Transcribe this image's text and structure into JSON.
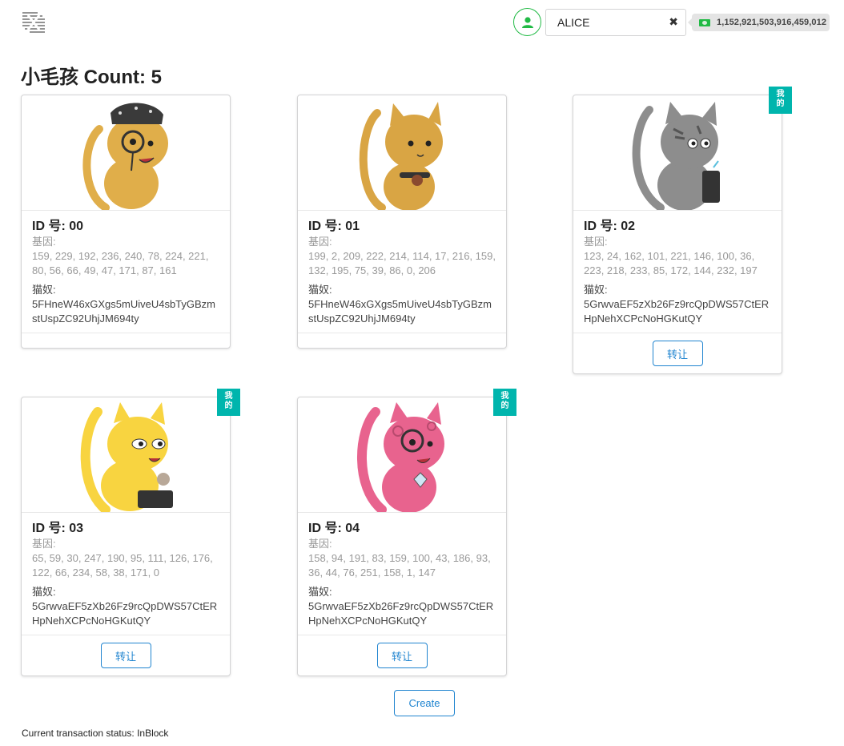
{
  "header": {
    "account_name": "ALICE",
    "account_clear_icon": "close-icon",
    "balance": "1,152,921,503,916,459,012",
    "balance_icon": "money-icon",
    "avatar_icon": "user-icon",
    "logo_icon": "substrate-logo"
  },
  "page": {
    "title": "小毛孩 Count: 5"
  },
  "labels": {
    "dna": "基因:",
    "owner": "猫奴:",
    "transfer": "转让",
    "mine_1": "我",
    "mine_2": "的"
  },
  "kitties": [
    {
      "id": "ID 号: 00",
      "dna": "159, 229, 192, 236, 240, 78, 224, 221, 80, 56, 66, 49, 47, 171, 87, 161",
      "owner": "5FHneW46xGXgs5mUiveU4sbTyGBzmstUspZC92UhjJM694ty",
      "mine": false,
      "color": "#e0ae4a"
    },
    {
      "id": "ID 号: 01",
      "dna": "199, 2, 209, 222, 214, 114, 17, 216, 159, 132, 195, 75, 39, 86, 0, 206",
      "owner": "5FHneW46xGXgs5mUiveU4sbTyGBzmstUspZC92UhjJM694ty",
      "mine": false,
      "color": "#d9a544"
    },
    {
      "id": "ID 号: 02",
      "dna": "123, 24, 162, 101, 221, 146, 100, 36, 223, 218, 233, 85, 172, 144, 232, 197",
      "owner": "5GrwvaEF5zXb26Fz9rcQpDWS57CtERHpNehXCPcNoHGKutQY",
      "mine": true,
      "color": "#8d8d8d"
    },
    {
      "id": "ID 号: 03",
      "dna": "65, 59, 30, 247, 190, 95, 111, 126, 176, 122, 66, 234, 58, 38, 171, 0",
      "owner": "5GrwvaEF5zXb26Fz9rcQpDWS57CtERHpNehXCPcNoHGKutQY",
      "mine": true,
      "color": "#f8d440"
    },
    {
      "id": "ID 号: 04",
      "dna": "158, 94, 191, 83, 159, 100, 43, 186, 93, 36, 44, 76, 251, 158, 1, 147",
      "owner": "5GrwvaEF5zXb26Fz9rcQpDWS57CtERHpNehXCPcNoHGKutQY",
      "mine": true,
      "color": "#e8638e"
    }
  ],
  "actions": {
    "create": "Create"
  },
  "status": {
    "text": "Current transaction status: InBlock"
  }
}
